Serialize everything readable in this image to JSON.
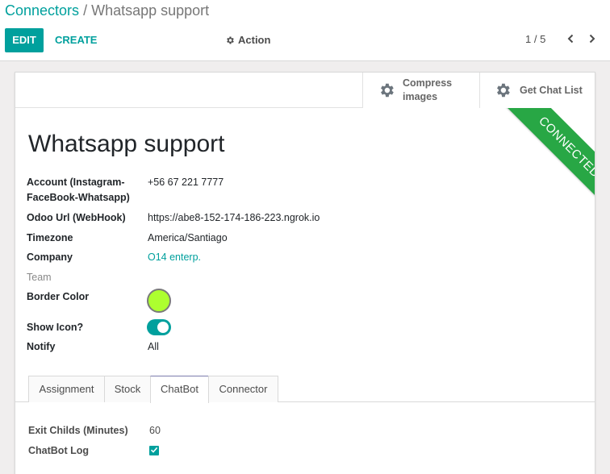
{
  "breadcrumb": {
    "parent": "Connectors",
    "separator": "/",
    "current": "Whatsapp support"
  },
  "toolbar": {
    "edit_label": "EDIT",
    "create_label": "CREATE",
    "action_label": "Action",
    "action_icon": "gear-icon"
  },
  "pager": {
    "text": "1 / 5",
    "current": 1,
    "total": 5
  },
  "button_box": {
    "compress_label": "Compress images",
    "chat_list_label": "Get Chat List"
  },
  "ribbon": {
    "label": "CONNECTED",
    "color": "#28a745"
  },
  "record": {
    "title": "Whatsapp support",
    "fields": {
      "account_label_line1": "Account (Instagram-",
      "account_label_line2": "FaceBook-Whatsapp)",
      "account_value": "+56 67 221 7777",
      "odoo_url_label": "Odoo Url (WebHook)",
      "odoo_url_value": "https://abe8-152-174-186-223.ngrok.io",
      "timezone_label": "Timezone",
      "timezone_value": "America/Santiago",
      "company_label": "Company",
      "company_value": "O14 enterp.",
      "team_label": "Team",
      "border_color_label": "Border Color",
      "border_color_value": "#adff2f",
      "show_icon_label": "Show Icon?",
      "show_icon_value": true,
      "notify_label": "Notify",
      "notify_value": "All"
    }
  },
  "tabs": [
    {
      "label": "Assignment",
      "active": false
    },
    {
      "label": "Stock",
      "active": false
    },
    {
      "label": "ChatBot",
      "active": true
    },
    {
      "label": "Connector",
      "active": false
    }
  ],
  "chatbot": {
    "exit_childs_label": "Exit Childs (Minutes)",
    "exit_childs_value": "60",
    "chatbot_log_label": "ChatBot Log",
    "chatbot_log_value": true
  },
  "colors": {
    "accent": "#00a09d",
    "active_tab_border": "#7c7bad"
  }
}
